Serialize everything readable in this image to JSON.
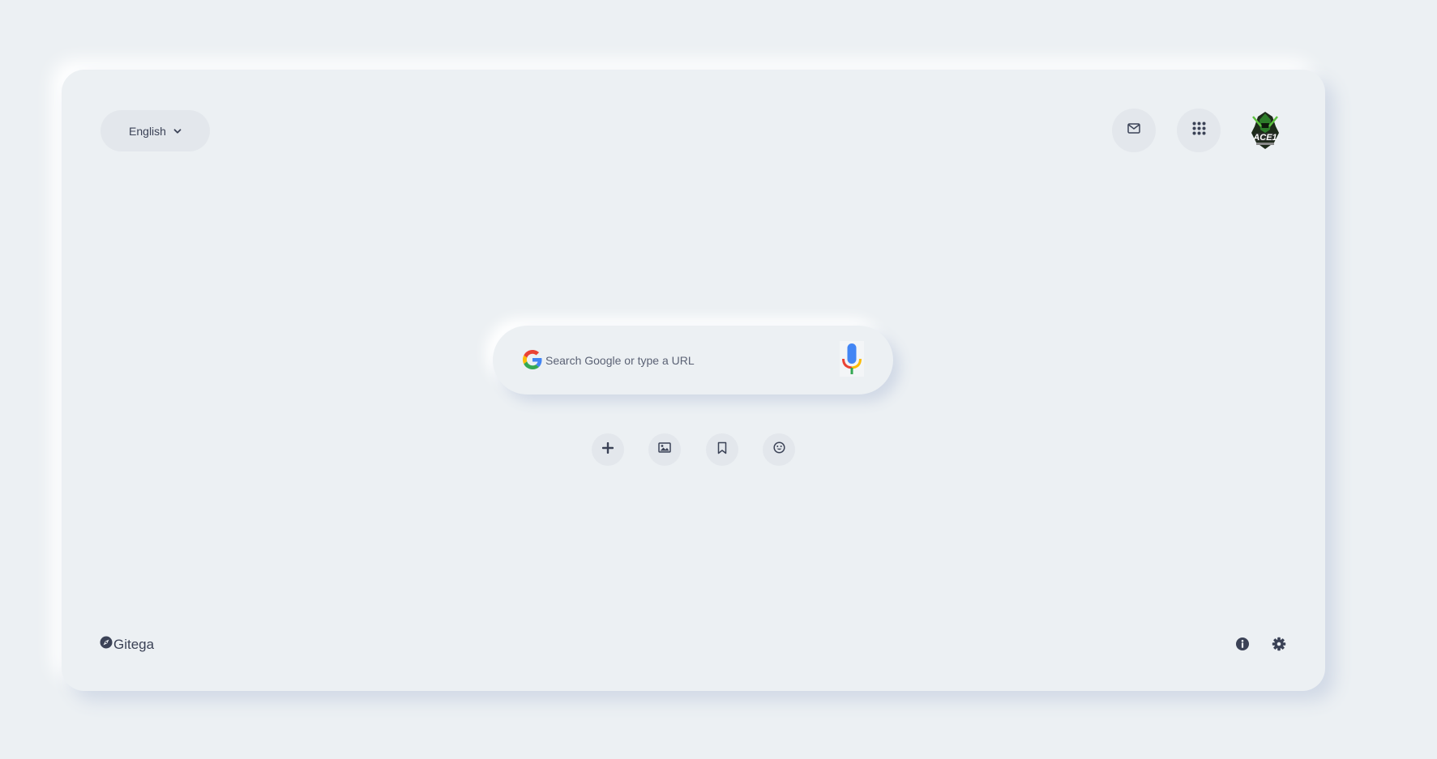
{
  "language": {
    "selected": "English",
    "icon": "chevron-down-icon"
  },
  "header": {
    "mail_icon": "mail-icon",
    "apps_icon": "apps-grid-icon",
    "avatar_alt": "ACE1"
  },
  "search": {
    "placeholder": "Search Google or type a URL",
    "value": "",
    "logo_icon": "google-g-icon",
    "voice_icon": "microphone-icon"
  },
  "quick_actions": [
    {
      "icon": "plus-icon"
    },
    {
      "icon": "image-icon"
    },
    {
      "icon": "bookmark-icon"
    },
    {
      "icon": "smiley-icon"
    }
  ],
  "footer": {
    "location": "Gitega",
    "location_icon": "compass-icon",
    "info_icon": "info-icon",
    "settings_icon": "gear-icon"
  },
  "colors": {
    "background": "#ecf0f3",
    "button_fill": "#e3e7ec",
    "text": "#3b4256",
    "icon": "#4a5270"
  }
}
